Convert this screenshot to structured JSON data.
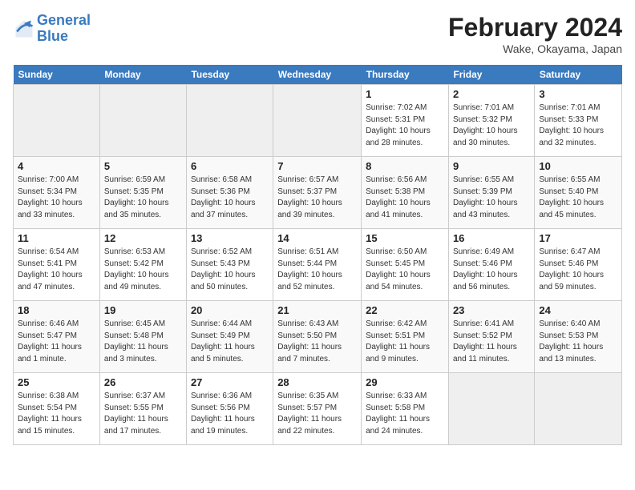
{
  "header": {
    "logo_line1": "General",
    "logo_line2": "Blue",
    "month": "February 2024",
    "location": "Wake, Okayama, Japan"
  },
  "weekdays": [
    "Sunday",
    "Monday",
    "Tuesday",
    "Wednesday",
    "Thursday",
    "Friday",
    "Saturday"
  ],
  "weeks": [
    [
      {
        "day": "",
        "empty": true
      },
      {
        "day": "",
        "empty": true
      },
      {
        "day": "",
        "empty": true
      },
      {
        "day": "",
        "empty": true
      },
      {
        "day": "1",
        "sunrise": "7:02 AM",
        "sunset": "5:31 PM",
        "daylight": "10 hours and 28 minutes."
      },
      {
        "day": "2",
        "sunrise": "7:01 AM",
        "sunset": "5:32 PM",
        "daylight": "10 hours and 30 minutes."
      },
      {
        "day": "3",
        "sunrise": "7:01 AM",
        "sunset": "5:33 PM",
        "daylight": "10 hours and 32 minutes."
      }
    ],
    [
      {
        "day": "4",
        "sunrise": "7:00 AM",
        "sunset": "5:34 PM",
        "daylight": "10 hours and 33 minutes."
      },
      {
        "day": "5",
        "sunrise": "6:59 AM",
        "sunset": "5:35 PM",
        "daylight": "10 hours and 35 minutes."
      },
      {
        "day": "6",
        "sunrise": "6:58 AM",
        "sunset": "5:36 PM",
        "daylight": "10 hours and 37 minutes."
      },
      {
        "day": "7",
        "sunrise": "6:57 AM",
        "sunset": "5:37 PM",
        "daylight": "10 hours and 39 minutes."
      },
      {
        "day": "8",
        "sunrise": "6:56 AM",
        "sunset": "5:38 PM",
        "daylight": "10 hours and 41 minutes."
      },
      {
        "day": "9",
        "sunrise": "6:55 AM",
        "sunset": "5:39 PM",
        "daylight": "10 hours and 43 minutes."
      },
      {
        "day": "10",
        "sunrise": "6:55 AM",
        "sunset": "5:40 PM",
        "daylight": "10 hours and 45 minutes."
      }
    ],
    [
      {
        "day": "11",
        "sunrise": "6:54 AM",
        "sunset": "5:41 PM",
        "daylight": "10 hours and 47 minutes."
      },
      {
        "day": "12",
        "sunrise": "6:53 AM",
        "sunset": "5:42 PM",
        "daylight": "10 hours and 49 minutes."
      },
      {
        "day": "13",
        "sunrise": "6:52 AM",
        "sunset": "5:43 PM",
        "daylight": "10 hours and 50 minutes."
      },
      {
        "day": "14",
        "sunrise": "6:51 AM",
        "sunset": "5:44 PM",
        "daylight": "10 hours and 52 minutes."
      },
      {
        "day": "15",
        "sunrise": "6:50 AM",
        "sunset": "5:45 PM",
        "daylight": "10 hours and 54 minutes."
      },
      {
        "day": "16",
        "sunrise": "6:49 AM",
        "sunset": "5:46 PM",
        "daylight": "10 hours and 56 minutes."
      },
      {
        "day": "17",
        "sunrise": "6:47 AM",
        "sunset": "5:46 PM",
        "daylight": "10 hours and 59 minutes."
      }
    ],
    [
      {
        "day": "18",
        "sunrise": "6:46 AM",
        "sunset": "5:47 PM",
        "daylight": "11 hours and 1 minute."
      },
      {
        "day": "19",
        "sunrise": "6:45 AM",
        "sunset": "5:48 PM",
        "daylight": "11 hours and 3 minutes."
      },
      {
        "day": "20",
        "sunrise": "6:44 AM",
        "sunset": "5:49 PM",
        "daylight": "11 hours and 5 minutes."
      },
      {
        "day": "21",
        "sunrise": "6:43 AM",
        "sunset": "5:50 PM",
        "daylight": "11 hours and 7 minutes."
      },
      {
        "day": "22",
        "sunrise": "6:42 AM",
        "sunset": "5:51 PM",
        "daylight": "11 hours and 9 minutes."
      },
      {
        "day": "23",
        "sunrise": "6:41 AM",
        "sunset": "5:52 PM",
        "daylight": "11 hours and 11 minutes."
      },
      {
        "day": "24",
        "sunrise": "6:40 AM",
        "sunset": "5:53 PM",
        "daylight": "11 hours and 13 minutes."
      }
    ],
    [
      {
        "day": "25",
        "sunrise": "6:38 AM",
        "sunset": "5:54 PM",
        "daylight": "11 hours and 15 minutes."
      },
      {
        "day": "26",
        "sunrise": "6:37 AM",
        "sunset": "5:55 PM",
        "daylight": "11 hours and 17 minutes."
      },
      {
        "day": "27",
        "sunrise": "6:36 AM",
        "sunset": "5:56 PM",
        "daylight": "11 hours and 19 minutes."
      },
      {
        "day": "28",
        "sunrise": "6:35 AM",
        "sunset": "5:57 PM",
        "daylight": "11 hours and 22 minutes."
      },
      {
        "day": "29",
        "sunrise": "6:33 AM",
        "sunset": "5:58 PM",
        "daylight": "11 hours and 24 minutes."
      },
      {
        "day": "",
        "empty": true
      },
      {
        "day": "",
        "empty": true
      }
    ]
  ]
}
